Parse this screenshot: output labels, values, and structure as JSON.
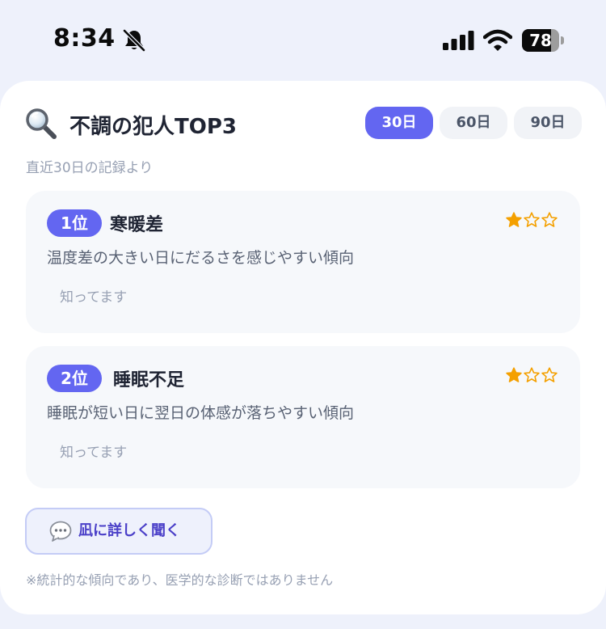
{
  "status_bar": {
    "time": "8:34",
    "battery_level": 78,
    "battery_text": "78",
    "icons": [
      "bell-slash-icon",
      "cellular-signal-icon",
      "wifi-icon",
      "battery-icon"
    ]
  },
  "card": {
    "icon": "magnifying-glass-icon",
    "title": "不調の犯人TOP3",
    "subtitle": "直近30日の記録より",
    "tabs": [
      {
        "label": "30日",
        "active": true
      },
      {
        "label": "60日",
        "active": false
      },
      {
        "label": "90日",
        "active": false
      }
    ],
    "items": [
      {
        "rank": "1位",
        "name": "寒暖差",
        "rating": 1,
        "rating_max": 3,
        "description": "温度差の大きい日にだるさを感じやすい傾向",
        "action_label": "知ってます"
      },
      {
        "rank": "2位",
        "name": "睡眠不足",
        "rating": 1,
        "rating_max": 3,
        "description": "睡眠が短い日に翌日の体感が落ちやすい傾向",
        "action_label": "知ってます"
      }
    ],
    "ask_button": {
      "icon": "speech-bubble-icon",
      "label": "凪に詳しく聞く"
    },
    "disclaimer": "※統計的な傾向であり、医学的な診断ではありません"
  },
  "colors": {
    "accent": "#6366f1",
    "star": "#f4a000",
    "page_bg": "#eef1fb",
    "item_bg": "#f6f8fb"
  }
}
